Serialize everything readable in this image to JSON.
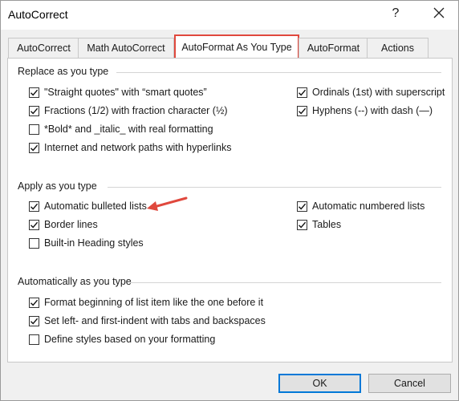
{
  "window": {
    "title": "AutoCorrect",
    "help_label": "?"
  },
  "tabs": [
    {
      "label": "AutoCorrect"
    },
    {
      "label": "Math AutoCorrect"
    },
    {
      "label": "AutoFormat As You Type",
      "active": true
    },
    {
      "label": "AutoFormat"
    },
    {
      "label": "Actions"
    }
  ],
  "replace_group": {
    "title": "Replace as you type",
    "left": [
      {
        "label": "\"Straight quotes\" with “smart quotes”",
        "checked": true
      },
      {
        "label": "Fractions (1/2) with fraction character (½)",
        "checked": true
      },
      {
        "label": "*Bold* and _italic_ with real formatting",
        "checked": false
      },
      {
        "label": "Internet and network paths with hyperlinks",
        "checked": true
      }
    ],
    "right": [
      {
        "label": "Ordinals (1st) with superscript",
        "checked": true
      },
      {
        "label": "Hyphens (--) with dash (—)",
        "checked": true
      }
    ]
  },
  "apply_group": {
    "title": "Apply as you type",
    "left": [
      {
        "label": "Automatic bulleted lists",
        "checked": true
      },
      {
        "label": "Border lines",
        "checked": true
      },
      {
        "label": "Built-in Heading styles",
        "checked": false
      }
    ],
    "right": [
      {
        "label": "Automatic numbered lists",
        "checked": true
      },
      {
        "label": "Tables",
        "checked": true
      }
    ]
  },
  "auto_group": {
    "title": "Automatically as you type",
    "items": [
      {
        "label": "Format beginning of list item like the one before it",
        "checked": true
      },
      {
        "label": "Set left- and first-indent with tabs and backspaces",
        "checked": true
      },
      {
        "label": "Define styles based on your formatting",
        "checked": false
      }
    ]
  },
  "buttons": {
    "ok": "OK",
    "cancel": "Cancel"
  },
  "colors": {
    "highlight": "#e0483d",
    "focus": "#0078d7"
  }
}
